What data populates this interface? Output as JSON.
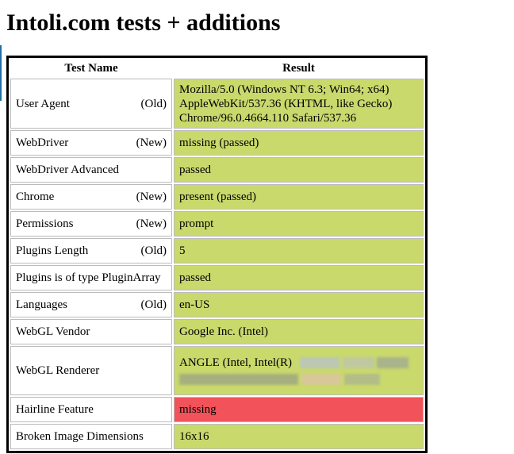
{
  "page": {
    "title": "Intoli.com tests + additions"
  },
  "table": {
    "headers": {
      "name": "Test Name",
      "result": "Result"
    },
    "rows": [
      {
        "name": "User Agent",
        "tag": "(Old)",
        "result_lines": [
          "Mozilla/5.0 (Windows NT 6.3; Win64; x64)",
          "AppleWebKit/537.36 (KHTML, like Gecko)",
          "Chrome/96.0.4664.110 Safari/537.36"
        ],
        "status": "passed"
      },
      {
        "name": "WebDriver",
        "tag": "(New)",
        "result": "missing (passed)",
        "status": "passed"
      },
      {
        "name": "WebDriver Advanced",
        "tag": "",
        "result": "passed",
        "status": "passed"
      },
      {
        "name": "Chrome",
        "tag": "(New)",
        "result": "present (passed)",
        "status": "passed"
      },
      {
        "name": "Permissions",
        "tag": "(New)",
        "result": "prompt",
        "status": "passed"
      },
      {
        "name": "Plugins Length",
        "tag": "(Old)",
        "result": "5",
        "status": "passed"
      },
      {
        "name": "Plugins is of type PluginArray",
        "tag": "",
        "result": "passed",
        "status": "passed"
      },
      {
        "name": "Languages",
        "tag": "(Old)",
        "result": "en-US",
        "status": "passed"
      },
      {
        "name": "WebGL Vendor",
        "tag": "",
        "result": "Google Inc. (Intel)",
        "status": "passed"
      },
      {
        "name": "WebGL Renderer",
        "tag": "",
        "result": "ANGLE (Intel, Intel(R)",
        "status": "passed"
      },
      {
        "name": "Hairline Feature",
        "tag": "",
        "result": "missing",
        "status": "failed"
      },
      {
        "name": "Broken Image Dimensions",
        "tag": "",
        "result": "16x16",
        "status": "passed"
      }
    ]
  },
  "colors": {
    "passed": "#c9d96c",
    "failed": "#f2525a"
  }
}
